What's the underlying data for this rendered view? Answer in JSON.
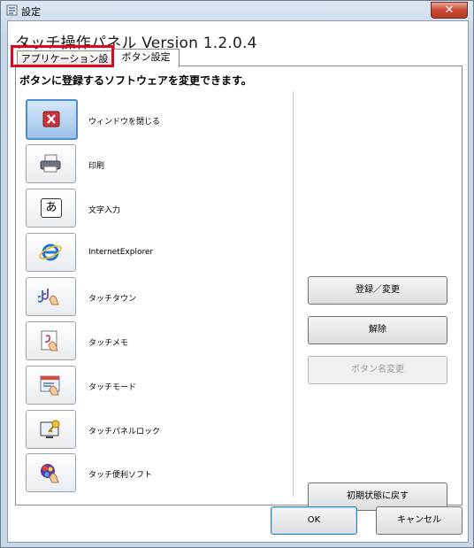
{
  "window": {
    "title": "設定",
    "close_glyph": "✕"
  },
  "app": {
    "title": "タッチ操作パネル  Version 1.2.0.4"
  },
  "tabs": [
    {
      "label": "アプリケーション設定"
    },
    {
      "label": "ボタン設定"
    }
  ],
  "panel": {
    "heading": "ボタンに登録するソフトウェアを変更できます。",
    "items": [
      {
        "label": "ウィンドウを閉じる",
        "icon": "close-window-icon"
      },
      {
        "label": "印刷",
        "icon": "printer-icon"
      },
      {
        "label": "文字入力",
        "icon": "hiragana-a-icon",
        "glyph": "あ"
      },
      {
        "label": "InternetExplorer",
        "icon": "internet-explorer-icon"
      },
      {
        "label": "タッチタウン",
        "icon": "touch-town-icon"
      },
      {
        "label": "タッチメモ",
        "icon": "touch-memo-icon"
      },
      {
        "label": "タッチモード",
        "icon": "touch-mode-icon"
      },
      {
        "label": "タッチパネルロック",
        "icon": "touch-panel-lock-icon"
      },
      {
        "label": "タッチ便利ソフト",
        "icon": "touch-utility-icon"
      }
    ],
    "actions": {
      "register": "登録／変更",
      "release": "解除",
      "rename": "ボタン名変更",
      "reset": "初期状態に戻す"
    }
  },
  "footer": {
    "ok": "OK",
    "cancel": "キャンセル"
  }
}
